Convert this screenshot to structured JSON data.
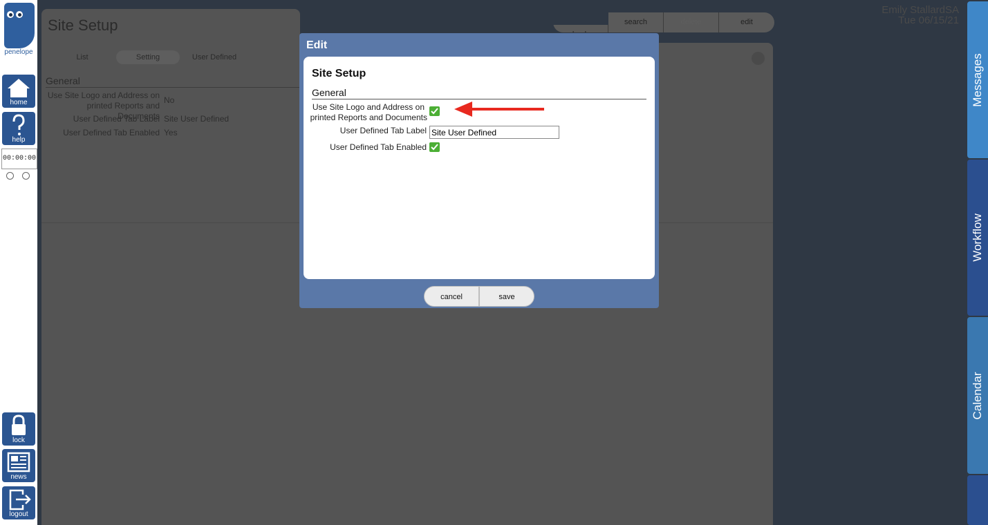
{
  "sidebar": {
    "logo_text": "penelope",
    "home_label": "home",
    "help_label": "help",
    "timer": "00:00:00",
    "lock_label": "lock",
    "news_label": "news",
    "logout_label": "logout"
  },
  "page": {
    "title": "Site Setup",
    "tabs": [
      "List",
      "Setting",
      "User Defined"
    ],
    "active_tab": "Setting",
    "section": "General",
    "fields": [
      {
        "label": "Use Site Logo and Address on printed Reports and Documents",
        "value": "No"
      },
      {
        "label": "User Defined Tab Label",
        "value": "Site User Defined"
      },
      {
        "label": "User Defined Tab Enabled",
        "value": "Yes"
      }
    ]
  },
  "toolbar": {
    "back": "back",
    "search": "search",
    "delete": "delete",
    "edit": "edit"
  },
  "user": {
    "name": "Emily StallardSA",
    "date": "Tue 06/15/21"
  },
  "right_tabs": {
    "messages": "Messages",
    "workflow": "Workflow",
    "calendar": "Calendar"
  },
  "modal": {
    "title": "Edit",
    "heading": "Site Setup",
    "section": "General",
    "field1_label_line1": "Use Site Logo and Address on",
    "field1_label_line2": "printed Reports and Documents",
    "field1_checked": true,
    "field2_label": "User Defined Tab Label",
    "field2_value": "Site User Defined",
    "field3_label": "User Defined Tab Enabled",
    "field3_checked": true,
    "cancel": "cancel",
    "save": "save"
  },
  "colors": {
    "sidebar_button": "#2b5591",
    "modal_frame": "#5a78a8",
    "checkbox": "#4caf35",
    "arrow": "#e8291f",
    "messages_tab": "#3f87c8",
    "workflow_tab": "#2b4f8f",
    "calendar_tab": "#3a78b0"
  }
}
